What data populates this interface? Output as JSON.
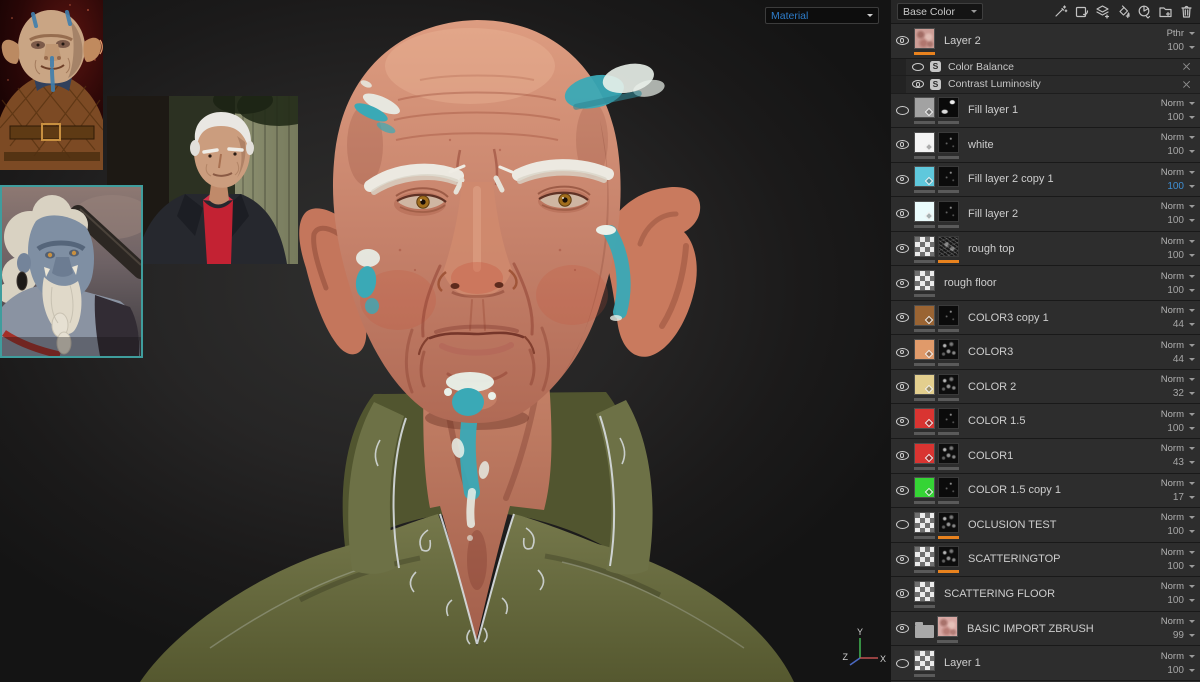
{
  "viewport": {
    "shader_dropdown": "Material",
    "axis_gizmo": {
      "x": "X",
      "y": "Y",
      "z": "Z"
    },
    "scene_colors": {
      "skin": "#c5826b",
      "face_paint": "#3aa9b6",
      "garment": "#6b6f45",
      "background": "#1f1e1e"
    }
  },
  "layers_panel": {
    "channel_dropdown": "Base Color",
    "toolbar_icons": [
      "add-effect-wand",
      "transform-stamp",
      "add-layer",
      "add-fill-layer",
      "add-smart-material",
      "add-folder",
      "delete-layer"
    ],
    "accent_orange": "#e8821e",
    "highlight_blue": "#3f8fd4",
    "layers": [
      {
        "name": "Layer 2",
        "blend": "Pthr",
        "opacity": "100",
        "visible": true,
        "swatch": "#cc9d96",
        "layer_bar": "orange",
        "opacity_active": false,
        "effects": [
          {
            "name": "Color Balance",
            "visible": false
          },
          {
            "name": "Contrast Luminosity",
            "visible": true
          }
        ]
      },
      {
        "name": "Fill layer 1",
        "blend": "Norm",
        "opacity": "100",
        "visible": false,
        "swatch": "#a2a2a2",
        "layer_bar": "gray",
        "mask_bar": "gray",
        "opacity_active": false
      },
      {
        "name": "white",
        "blend": "Norm",
        "opacity": "100",
        "visible": true,
        "swatch": "#f4f4f4",
        "layer_bar": "gray",
        "mask_bar": "gray",
        "opacity_active": false
      },
      {
        "name": "Fill layer 2 copy 1",
        "blend": "Norm",
        "opacity": "100",
        "visible": true,
        "swatch": "#5fc8dc",
        "layer_bar": "gray",
        "mask_bar": "gray",
        "opacity_active": true
      },
      {
        "name": "Fill layer 2",
        "blend": "Norm",
        "opacity": "100",
        "visible": true,
        "swatch": "#eafbfc",
        "layer_bar": "gray",
        "mask_bar": "gray",
        "opacity_active": false
      },
      {
        "name": "rough top",
        "blend": "Norm",
        "opacity": "100",
        "visible": true,
        "swatch": null,
        "layer_bar": "gray",
        "mask_bar": "orange",
        "opacity_active": false
      },
      {
        "name": "rough floor",
        "blend": "Norm",
        "opacity": "100",
        "visible": true,
        "swatch": null,
        "layer_bar": "gray",
        "opacity_active": false
      },
      {
        "name": "COLOR3 copy 1",
        "blend": "Norm",
        "opacity": "44",
        "visible": true,
        "swatch": "#9a6433",
        "layer_bar": "gray",
        "mask_bar": "gray",
        "opacity_active": false
      },
      {
        "name": "COLOR3",
        "blend": "Norm",
        "opacity": "44",
        "visible": true,
        "swatch": "#e09a6a",
        "layer_bar": "gray",
        "mask_bar": "gray",
        "opacity_active": false
      },
      {
        "name": "COLOR 2",
        "blend": "Norm",
        "opacity": "32",
        "visible": true,
        "swatch": "#e3cf8e",
        "layer_bar": "gray",
        "mask_bar": "gray",
        "opacity_active": false
      },
      {
        "name": "COLOR 1.5",
        "blend": "Norm",
        "opacity": "100",
        "visible": true,
        "swatch": "#d93431",
        "layer_bar": "gray",
        "mask_bar": "gray",
        "opacity_active": false
      },
      {
        "name": "COLOR1",
        "blend": "Norm",
        "opacity": "43",
        "visible": true,
        "swatch": "#d93431",
        "layer_bar": "gray",
        "mask_bar": "gray",
        "opacity_active": false
      },
      {
        "name": "COLOR 1.5 copy 1",
        "blend": "Norm",
        "opacity": "17",
        "visible": true,
        "swatch": "#35d435",
        "layer_bar": "gray",
        "mask_bar": "gray",
        "opacity_active": false
      },
      {
        "name": "OCLUSION TEST",
        "blend": "Norm",
        "opacity": "100",
        "visible": false,
        "swatch": null,
        "layer_bar": "gray",
        "mask_bar": "orange",
        "opacity_active": false
      },
      {
        "name": "SCATTERINGTOP",
        "blend": "Norm",
        "opacity": "100",
        "visible": true,
        "swatch": null,
        "layer_bar": "gray",
        "mask_bar": "orange",
        "opacity_active": false
      },
      {
        "name": "SCATTERING FLOOR",
        "blend": "Norm",
        "opacity": "100",
        "visible": true,
        "swatch": null,
        "layer_bar": "gray",
        "opacity_active": false
      },
      {
        "name": "BASIC IMPORT ZBRUSH",
        "blend": "Norm",
        "opacity": "99",
        "visible": true,
        "swatch": "#d8a8a4",
        "layer_bar": "gray",
        "folder": true,
        "opacity_active": false
      },
      {
        "name": "Layer 1",
        "blend": "Norm",
        "opacity": "100",
        "visible": false,
        "swatch": null,
        "layer_bar": "gray",
        "opacity_active": false
      }
    ]
  }
}
